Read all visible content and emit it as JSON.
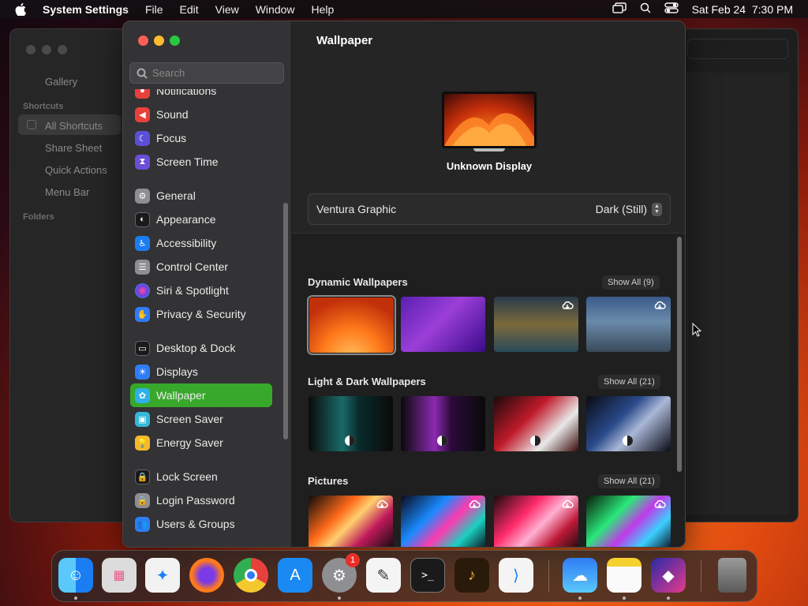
{
  "menubar": {
    "app_name": "System Settings",
    "menus": [
      "File",
      "Edit",
      "View",
      "Window",
      "Help"
    ],
    "datetime": "Sat Feb 24  7:30 PM"
  },
  "background_window": {
    "items": [
      "Gallery"
    ],
    "sections": [
      {
        "title": "Shortcuts",
        "items": [
          "All Shortcuts",
          "Share Sheet",
          "Quick Actions",
          "Menu Bar"
        ]
      },
      {
        "title": "Folders",
        "items": []
      }
    ]
  },
  "sidebar": {
    "search_placeholder": "Search",
    "items": [
      {
        "label": "Notifications",
        "icon": "bell-icon",
        "color": "#e8413b"
      },
      {
        "label": "Sound",
        "icon": "speaker-icon",
        "color": "#e8413b"
      },
      {
        "label": "Focus",
        "icon": "moon-icon",
        "color": "#5b4fd6"
      },
      {
        "label": "Screen Time",
        "icon": "hourglass-icon",
        "color": "#6a4fd6"
      },
      {
        "label": "General",
        "icon": "gear-icon",
        "color": "#8e8e93"
      },
      {
        "label": "Appearance",
        "icon": "appearance-icon",
        "color": "#1a1a1a"
      },
      {
        "label": "Accessibility",
        "icon": "accessibility-icon",
        "color": "#1a7ef2"
      },
      {
        "label": "Control Center",
        "icon": "control-center-icon",
        "color": "#8e8e93"
      },
      {
        "label": "Siri & Spotlight",
        "icon": "siri-icon",
        "color": "#9b3fd0"
      },
      {
        "label": "Privacy & Security",
        "icon": "hand-icon",
        "color": "#2f7df6"
      },
      {
        "label": "Desktop & Dock",
        "icon": "dock-icon",
        "color": "#1a1a1a"
      },
      {
        "label": "Displays",
        "icon": "sun-icon",
        "color": "#2f7df6"
      },
      {
        "label": "Wallpaper",
        "icon": "wallpaper-icon",
        "color": "#30b0e8"
      },
      {
        "label": "Screen Saver",
        "icon": "screensaver-icon",
        "color": "#35b8d8"
      },
      {
        "label": "Energy Saver",
        "icon": "lightbulb-icon",
        "color": "#f5b82e"
      },
      {
        "label": "Lock Screen",
        "icon": "lock-icon",
        "color": "#1a1a1a"
      },
      {
        "label": "Login Password",
        "icon": "lock-icon",
        "color": "#8e8e93"
      },
      {
        "label": "Users & Groups",
        "icon": "users-icon",
        "color": "#2f7df6"
      }
    ],
    "selected": "Wallpaper"
  },
  "content": {
    "title": "Wallpaper",
    "display_name": "Unknown Display",
    "current_wallpaper": "Ventura Graphic",
    "current_style": "Dark (Still)",
    "sections": [
      {
        "title": "Dynamic Wallpapers",
        "show_all": "Show All (9)"
      },
      {
        "title": "Light & Dark Wallpapers",
        "show_all": "Show All (21)"
      },
      {
        "title": "Pictures",
        "show_all": "Show All (21)"
      }
    ]
  },
  "dock": {
    "apps": [
      {
        "name": "Finder",
        "icon": "finder-icon"
      },
      {
        "name": "Launchpad",
        "icon": "launchpad-icon"
      },
      {
        "name": "Safari",
        "icon": "safari-icon"
      },
      {
        "name": "Firefox",
        "icon": "firefox-icon"
      },
      {
        "name": "Chrome",
        "icon": "chrome-icon"
      },
      {
        "name": "App Store",
        "icon": "appstore-icon"
      },
      {
        "name": "System Settings",
        "icon": "system-settings-icon",
        "badge": "1"
      },
      {
        "name": "TextEdit",
        "icon": "textedit-icon"
      },
      {
        "name": "Terminal",
        "icon": "terminal-icon"
      },
      {
        "name": "GarageBand",
        "icon": "garageband-icon"
      },
      {
        "name": "VS Code",
        "icon": "vscode-icon"
      },
      {
        "name": "Weather",
        "icon": "weather-icon"
      },
      {
        "name": "Notes",
        "icon": "notes-icon"
      },
      {
        "name": "Shortcuts",
        "icon": "shortcuts-icon"
      },
      {
        "name": "Trash",
        "icon": "trash-icon"
      }
    ]
  }
}
